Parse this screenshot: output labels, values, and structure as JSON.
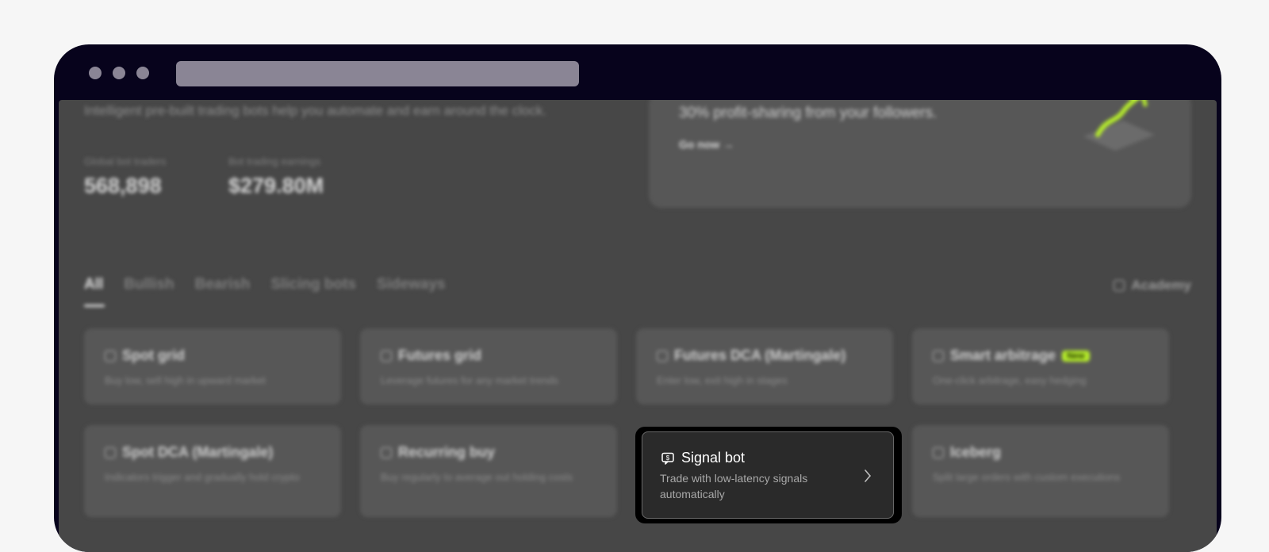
{
  "hero": {
    "subtitle": "Intelligent pre-built trading bots help you automate and earn around the clock.",
    "stats": [
      {
        "label": "Global bot traders",
        "value": "568,898"
      },
      {
        "label": "Bot trading earnings",
        "value": "$279.80M"
      }
    ]
  },
  "promo": {
    "text": "30% profit-sharing from your followers.",
    "cta": "Go now"
  },
  "tabs": [
    "All",
    "Bullish",
    "Bearish",
    "Slicing bots",
    "Sideways"
  ],
  "academy_label": "Academy",
  "cards": [
    {
      "title": "Spot grid",
      "desc": "Buy low, sell high in upward market",
      "icon": "grid-icon"
    },
    {
      "title": "Futures grid",
      "desc": "Leverage futures for any market trends",
      "icon": "futures-grid-icon"
    },
    {
      "title": "Futures DCA (Martingale)",
      "desc": "Enter low, exit high in stages",
      "icon": "martingale-icon"
    },
    {
      "title": "Smart arbitrage",
      "badge": "New",
      "desc": "One-click arbitrage, easy hedging",
      "icon": "arbitrage-icon"
    },
    {
      "title": "Spot DCA (Martingale)",
      "desc": "Indicators trigger and gradually hold crypto",
      "icon": "dca-icon"
    },
    {
      "title": "Recurring buy",
      "desc": "Buy regularly to average out holding costs",
      "icon": "calendar-icon"
    },
    {
      "title": "Signal bot",
      "desc": "Trade with low-latency signals automatically",
      "icon": "signal-icon"
    },
    {
      "title": "Iceberg",
      "desc": "Split large orders with custom executions",
      "icon": "iceberg-icon"
    }
  ],
  "colors": {
    "accent": "#b7ef2b",
    "background": "#474747",
    "frame": "#07031c"
  }
}
